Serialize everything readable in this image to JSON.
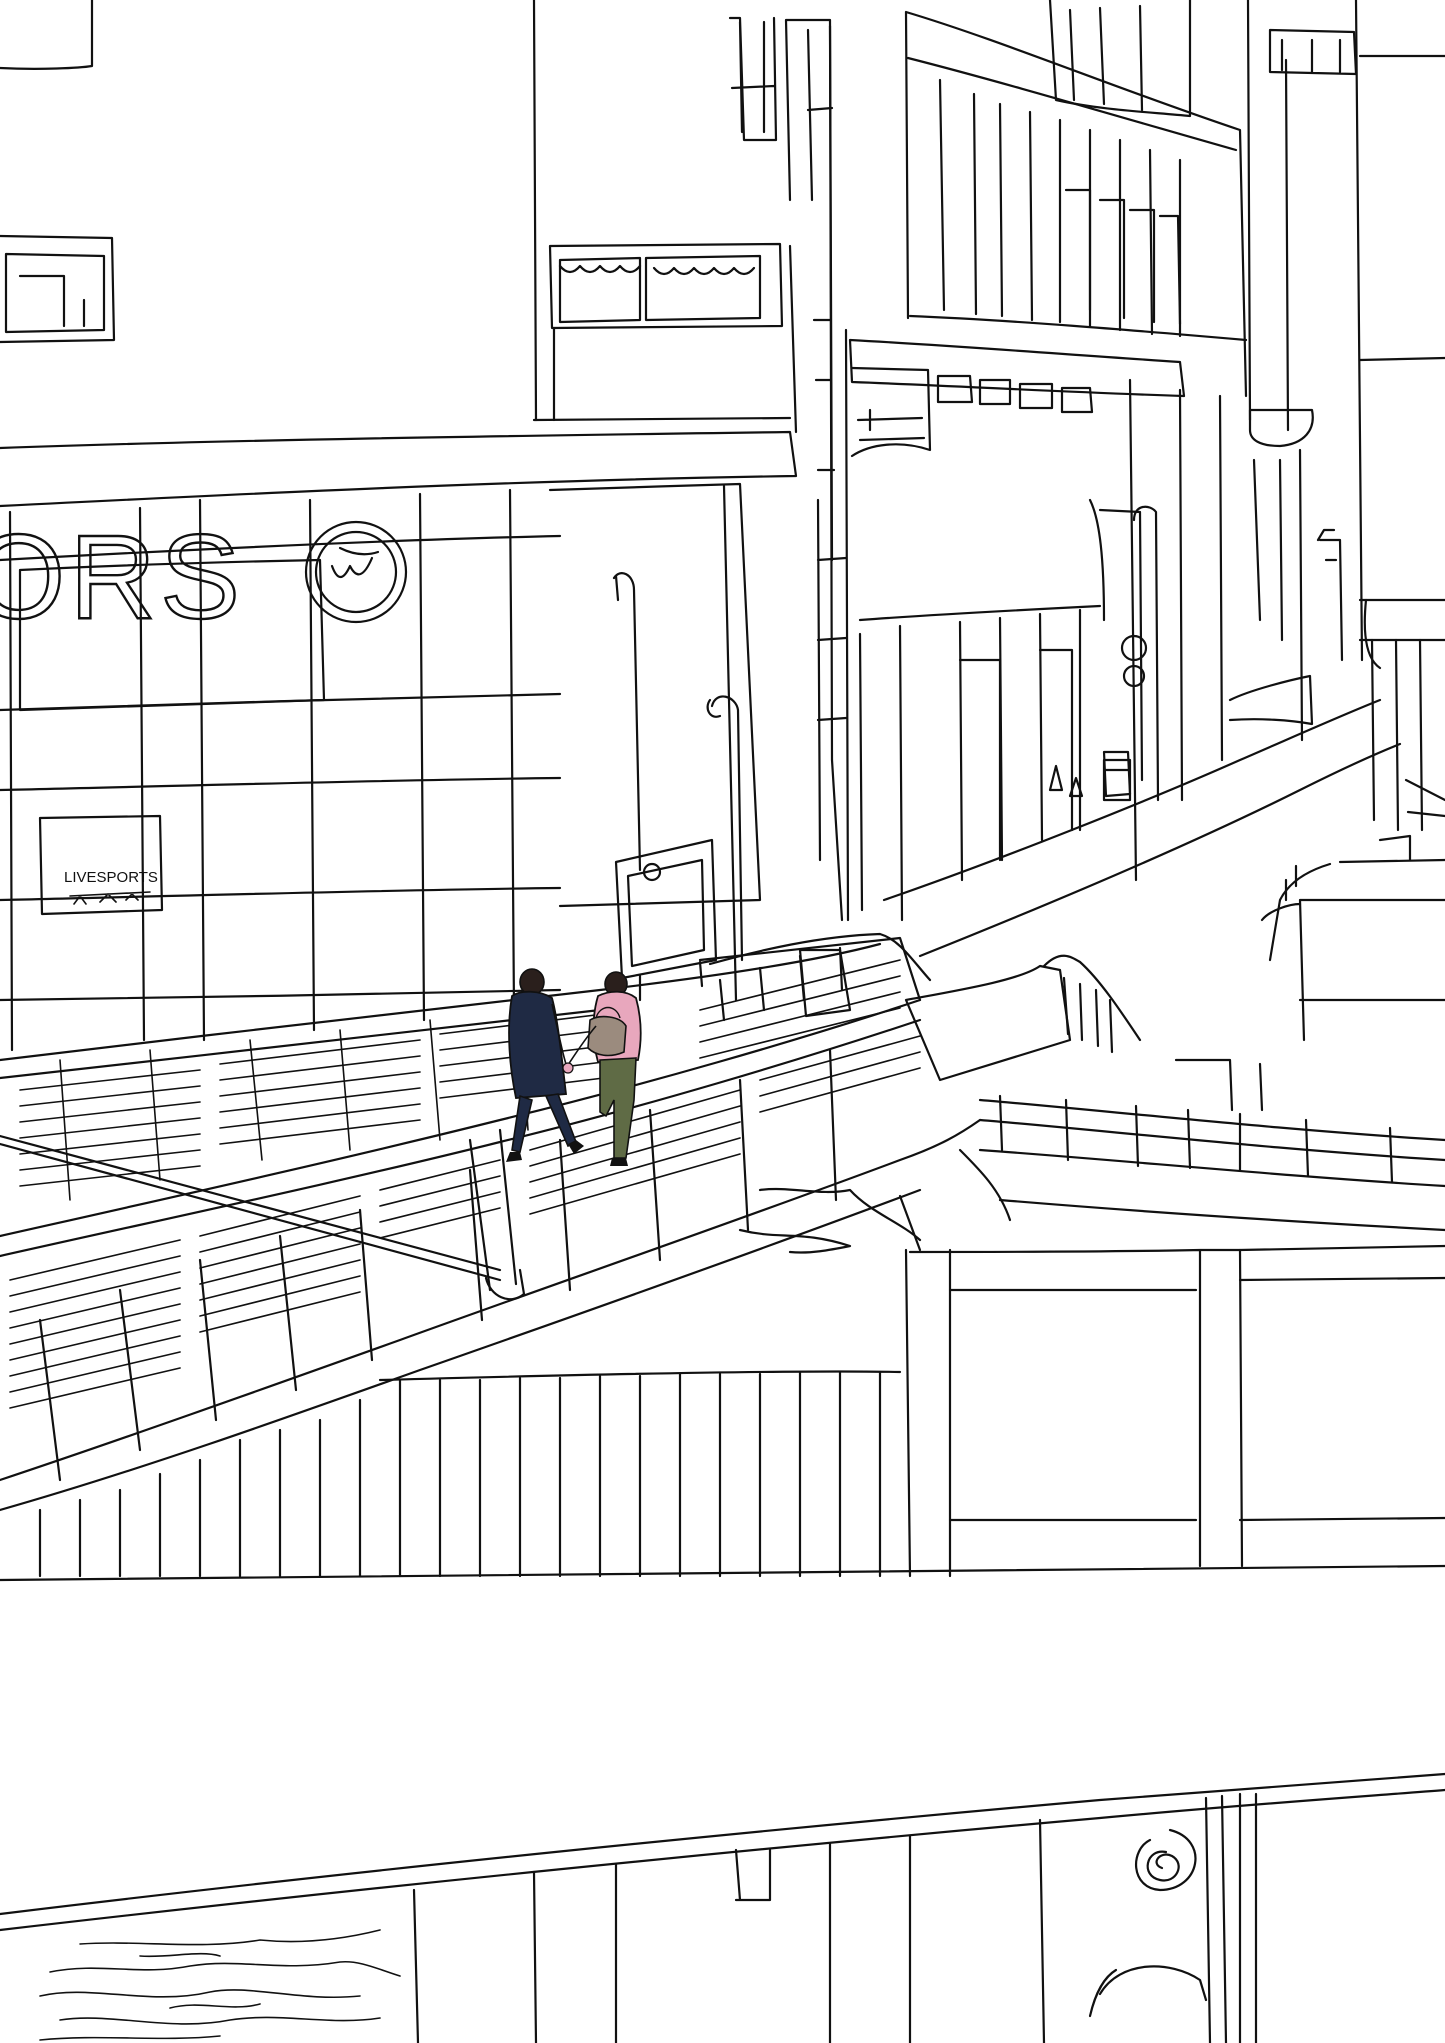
{
  "image": {
    "style": "line-art illustration",
    "colors": {
      "background": "#ffffff",
      "line": "#111111",
      "coat_navy": "#1f2a44",
      "hoodie_pink": "#e8a7bd",
      "pants_olive": "#5f6b45",
      "bag_taupe": "#9b8b7e",
      "hair_dark": "#2a1f1c"
    }
  },
  "signs": {
    "store_letters": "ORS",
    "small_sign": "LIVESPORTS"
  }
}
